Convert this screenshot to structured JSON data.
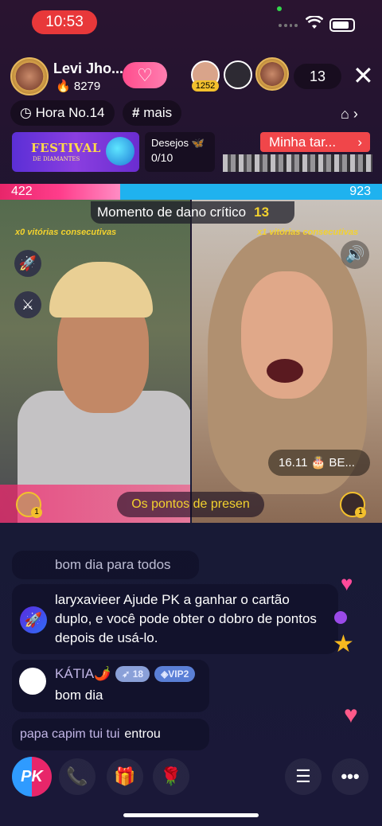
{
  "status": {
    "time": "10:53"
  },
  "host": {
    "name": "Levi Jho...",
    "likes": "8279",
    "heart_icon": "♡"
  },
  "viewers": {
    "badge": "1252",
    "count": "13"
  },
  "chips": {
    "hora": "Hora No.14",
    "mais": "mais"
  },
  "banner": {
    "festival_title": "FESTIVAL",
    "festival_sub": "DE DIAMANTES",
    "desejos_label": "Desejos",
    "desejos_value": "0/10",
    "minha_label": "Minha tar..."
  },
  "pk": {
    "left_score": "422",
    "right_score": "923",
    "left_fraction": 0.314,
    "crit_label": "Momento de dano crítico",
    "crit_value": "13",
    "left_streak": "x0 vitórias consecutivas",
    "right_streak": "x1 vitórias consecutivas",
    "pontos_label": "Os pontos de presen",
    "bday_label": "16.11 🎂 BE...",
    "mini_badge": "1"
  },
  "chat": [
    {
      "text": "bom dia para todos"
    },
    {
      "text": "laryxavieer Ajude PK a ganhar o cartão duplo, e você pode obter o dobro de pontos depois de usá-lo."
    },
    {
      "name": "KÁTIA🌶️",
      "level": "18",
      "vip": "VIP2",
      "text": "bom dia"
    },
    {
      "name": "papa capim tui tui",
      "action": "entrou"
    }
  ],
  "colors": {
    "pk_red": "#e8266a",
    "pk_blue": "#1fb2ef",
    "accent_yellow": "#f3d22e"
  },
  "bottom": {
    "pk_label": "PK"
  }
}
